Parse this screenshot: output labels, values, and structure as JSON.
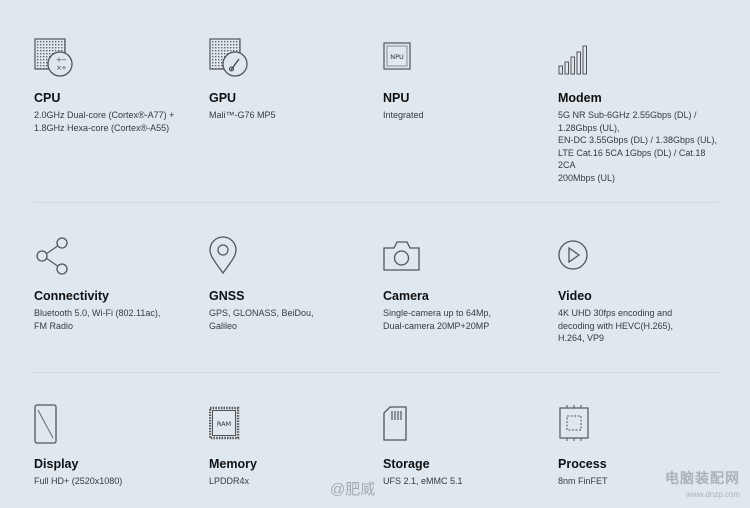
{
  "specs": [
    {
      "icon": "cpu-chip-icon",
      "title": "CPU",
      "desc": "2.0GHz Dual-core (Cortex®-A77) +\n1.8GHz Hexa-core (Cortex®-A55)"
    },
    {
      "icon": "gpu-chip-icon",
      "title": "GPU",
      "desc": "Mali™-G76 MP5"
    },
    {
      "icon": "npu-chip-icon",
      "title": "NPU",
      "desc": "Integrated",
      "icon_label": "NPU"
    },
    {
      "icon": "signal-bars-icon",
      "title": "Modem",
      "desc": "5G NR Sub-6GHz 2.55Gbps (DL) /\n1.28Gbps (UL),\nEN-DC 3.55Gbps (DL) / 1.38Gbps (UL),\nLTE Cat.16 5CA 1Gbps (DL) / Cat.18 2CA\n200Mbps (UL)"
    },
    {
      "icon": "share-icon",
      "title": "Connectivity",
      "desc": "Bluetooth 5.0, Wi-Fi (802.11ac),\nFM Radio"
    },
    {
      "icon": "location-pin-icon",
      "title": "GNSS",
      "desc": "GPS, GLONASS, BeiDou,\nGalileo"
    },
    {
      "icon": "camera-icon",
      "title": "Camera",
      "desc": "Single-camera up to 64Mp,\nDual-camera 20MP+20MP"
    },
    {
      "icon": "play-circle-icon",
      "title": "Video",
      "desc": "4K UHD 30fps encoding and\ndecoding with HEVC(H.265),\nH.264, VP9"
    },
    {
      "icon": "phone-display-icon",
      "title": "Display",
      "desc": "Full HD+ (2520x1080)"
    },
    {
      "icon": "ram-chip-icon",
      "title": "Memory",
      "desc": "LPDDR4x",
      "icon_label": "RAM"
    },
    {
      "icon": "sd-card-icon",
      "title": "Storage",
      "desc": "UFS 2.1, eMMC 5.1"
    },
    {
      "icon": "process-chip-icon",
      "title": "Process",
      "desc": "8nm FinFET"
    }
  ],
  "watermark": {
    "weibo": "@肥威",
    "site_cn": "电脑装配网",
    "site_url": "www.dnzp.com"
  },
  "colors": {
    "background": "#dfe8ef",
    "icon_stroke": "#555555",
    "divider": "#cdd8e0"
  }
}
